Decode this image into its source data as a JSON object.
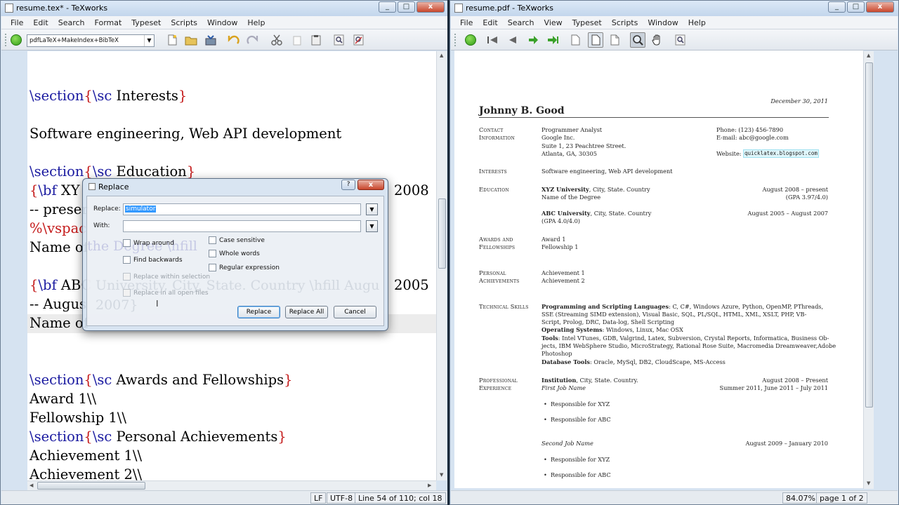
{
  "left_window": {
    "title": "resume.tex* - TeXworks",
    "menu": [
      "File",
      "Edit",
      "Search",
      "Format",
      "Typeset",
      "Scripts",
      "Window",
      "Help"
    ],
    "toolbar": {
      "typeset_engine": "pdfLaTeX+MakeIndex+BibTeX",
      "icons": [
        "typeset-icon",
        "new-file-icon",
        "open-folder-icon",
        "save-icon",
        "undo-icon",
        "redo-icon",
        "cut-icon",
        "copy-icon",
        "paste-icon",
        "find-icon",
        "replace-icon"
      ]
    },
    "editor_lines": [
      {
        "parts": [
          {
            "t": "\\section",
            "c": "kw"
          },
          {
            "t": "{",
            "c": "br"
          },
          {
            "t": "\\sc",
            "c": "kw"
          },
          {
            "t": " Interests",
            "c": ""
          },
          {
            "t": "}",
            "c": "br"
          }
        ]
      },
      {
        "parts": [
          {
            "t": "Software engineering, Web API development",
            "c": ""
          }
        ]
      },
      {
        "parts": [
          {
            "t": "\\section",
            "c": "kw"
          },
          {
            "t": "{",
            "c": "br"
          },
          {
            "t": "\\sc",
            "c": "kw"
          },
          {
            "t": " Education",
            "c": ""
          },
          {
            "t": "}",
            "c": "br"
          }
        ]
      },
      {
        "parts": [
          {
            "t": "{",
            "c": "br"
          },
          {
            "t": "\\bf",
            "c": "kw"
          },
          {
            "t": " XY",
            "c": ""
          }
        ]
      },
      {
        "parts": [
          {
            "t": "2008",
            "c": ""
          }
        ]
      },
      {
        "parts": [
          {
            "t": "-- preser",
            "c": ""
          }
        ]
      },
      {
        "parts": [
          {
            "t": "%\\vspac",
            "c": "cm"
          }
        ]
      },
      {
        "parts": [
          {
            "t": "Name of",
            "c": ""
          }
        ]
      },
      {
        "parts": [
          {
            "t": "{",
            "c": "br"
          },
          {
            "t": "\\bf",
            "c": "kw"
          },
          {
            "t": " ABC",
            "c": ""
          }
        ]
      },
      {
        "parts": [
          {
            "t": "2005",
            "c": ""
          }
        ]
      },
      {
        "parts": [
          {
            "t": "-- Augus",
            "c": ""
          }
        ]
      },
      {
        "parts": [
          {
            "t": "Name of",
            "c": ""
          }
        ]
      },
      {
        "parts": [
          {
            "t": "\\section",
            "c": "kw"
          },
          {
            "t": "{",
            "c": "br"
          },
          {
            "t": "\\sc",
            "c": "kw"
          },
          {
            "t": " Awards and Fellowships",
            "c": ""
          },
          {
            "t": "}",
            "c": "br"
          }
        ]
      },
      {
        "parts": [
          {
            "t": "Award 1\\\\",
            "c": ""
          }
        ]
      },
      {
        "parts": [
          {
            "t": "Fellowship 1\\\\",
            "c": ""
          }
        ]
      },
      {
        "parts": [
          {
            "t": "\\section",
            "c": "kw"
          },
          {
            "t": "{",
            "c": "br"
          },
          {
            "t": "\\sc",
            "c": "kw"
          },
          {
            "t": " Personal Achievements",
            "c": ""
          },
          {
            "t": "}",
            "c": "br"
          }
        ]
      },
      {
        "parts": [
          {
            "t": "Achievement 1\\\\",
            "c": ""
          }
        ]
      },
      {
        "parts": [
          {
            "t": "Achievement 2\\\\",
            "c": ""
          }
        ]
      }
    ],
    "status": {
      "line_ending": "LF",
      "encoding": "UTF-8",
      "position": "Line 54 of 110; col 18"
    }
  },
  "replace_dialog": {
    "title": "Replace",
    "help": "?",
    "close": "x",
    "replace_label": "Replace:",
    "replace_value": "simulator",
    "with_label": "With:",
    "with_value": "",
    "options_left": [
      {
        "label": "Wrap around",
        "checked": false,
        "enabled": true
      },
      {
        "label": "Find backwards",
        "checked": false,
        "enabled": true
      },
      {
        "label": "Replace within selection",
        "checked": false,
        "enabled": false
      },
      {
        "label": "Replace in all open files",
        "checked": false,
        "enabled": false
      }
    ],
    "options_right": [
      {
        "label": "Case sensitive",
        "checked": false
      },
      {
        "label": "Whole words",
        "checked": false
      },
      {
        "label": "Regular expression",
        "checked": false
      }
    ],
    "buttons": {
      "replace": "Replace",
      "replace_all": "Replace All",
      "cancel": "Cancel"
    }
  },
  "right_window": {
    "title": "resume.pdf - TeXworks",
    "menu": [
      "File",
      "Edit",
      "Search",
      "View",
      "Typeset",
      "Scripts",
      "Window",
      "Help"
    ],
    "toolbar_icons": [
      "typeset-icon",
      "first-page-icon",
      "previous-page-icon",
      "next-page-icon",
      "last-page-icon",
      "actual-size-icon",
      "fit-width-icon",
      "fit-window-icon",
      "magnify-icon",
      "hand-icon",
      "find-icon"
    ],
    "status": {
      "zoom": "84.07%",
      "page": "page 1 of 2"
    },
    "pdf": {
      "date": "December 30, 2011",
      "name": "Johnny B. Good",
      "contact": {
        "heading1": "Contact",
        "heading2": "Information",
        "lines": [
          "Programmer Analyst",
          "Google Inc.",
          "Suite 1, 23 Peachtree Street.",
          "Atlanta, GA, 30305"
        ],
        "phone": "Phone: (123) 456-7890",
        "email": "E-mail: abc@google.com",
        "website_label": "Website:",
        "website": "quicklatex.blogspot.com"
      },
      "interests": {
        "heading": "Interests",
        "text": "Software engineering, Web API development"
      },
      "education": {
        "heading": "Education",
        "entries": [
          {
            "school": "XYZ University",
            "place": ", City, State. Country",
            "dates": "August 2008 – present",
            "detail": "Name of the Degree",
            "gpa": "(GPA 3.97/4.0)"
          },
          {
            "school": "ABC University",
            "place": ", City, State. Country",
            "dates": "August 2005 – August 2007",
            "detail": "(GPA 4.0/4.0)"
          }
        ]
      },
      "awards": {
        "heading1": "Awards and",
        "heading2": "Fellowships",
        "items": [
          "Award 1",
          "Fellowship 1"
        ]
      },
      "achievements": {
        "heading1": "Personal",
        "heading2": "Achievements",
        "items": [
          "Achievement 1",
          "Achievement 2"
        ]
      },
      "skills": {
        "heading": "Technical Skills",
        "prog_label": "Programming and Scripting Languages",
        "prog_l1": ": C, C#, Windows Azure, Python, OpenMP, PThreads,",
        "prog_l2": "SSE (Streaming SIMD extension), Visual Basic, SQL, PL/SQL, HTML, XML, XSLT, PHP, VB-",
        "prog_l3": "Script, Prolog, DRC, Data-log, Shell Scripting",
        "os_label": "Operating Systems",
        "os_text": ": Windows, Linux, Mac OSX",
        "tools_label": "Tools",
        "tools_l1": ": Intel VTunes, GDB, Valgrind, Latex, Subversion, Crystal Reports, Informatica, Business Ob-",
        "tools_l2": "jects, IBM WebSphere Studio, MicroStrategy, Rational Rose Suite, Macromedia Dreamweaver,Adobe",
        "tools_l3": "Photoshop",
        "db_label": "Database Tools",
        "db_text": ": Oracle, MySql, DB2, CloudScape, MS-Access"
      },
      "experience": {
        "heading1": "Professional",
        "heading2": "Experience",
        "institution": "Institution",
        "place": ", City, State. Country.",
        "dates": "August 2008 – Present",
        "job1": "First Job Name",
        "job1_dates": "Summer 2011, June 2011 – July 2011",
        "job1_items": [
          "Responsible for XYZ",
          "Responsible for ABC"
        ],
        "job2": "Second Job Name",
        "job2_dates": "August 2009 – January 2010",
        "job2_items": [
          "Responsible for XYZ",
          "Responsible for ABC"
        ]
      }
    }
  }
}
